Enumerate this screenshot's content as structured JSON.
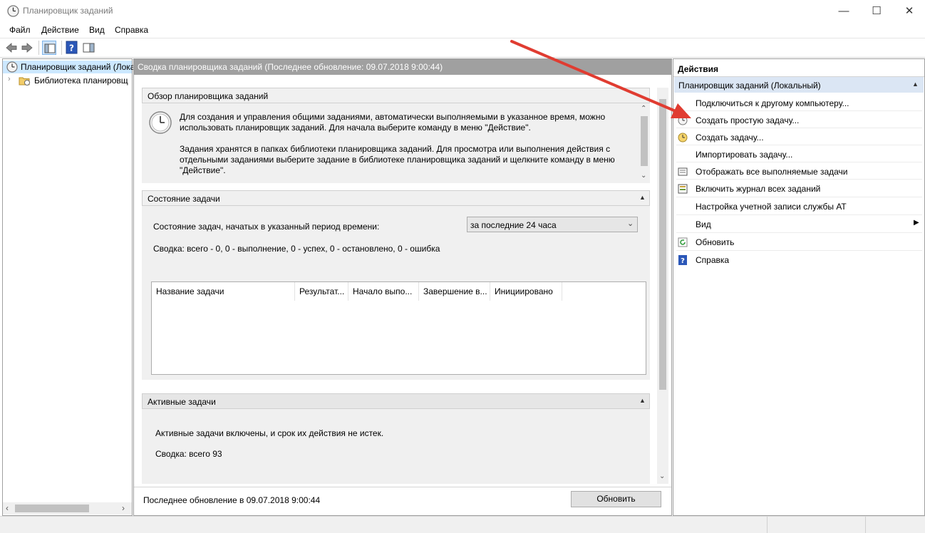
{
  "window": {
    "title": "Планировщик заданий",
    "minimize": "—",
    "maximize": "☐",
    "close": "✕"
  },
  "menu": {
    "items": [
      "Файл",
      "Действие",
      "Вид",
      "Справка"
    ]
  },
  "tree": {
    "root": "Планировщик заданий (Лока",
    "library": "Библиотека планировщ"
  },
  "center": {
    "header": "Сводка планировщика заданий (Последнее обновление: 09.07.2018 9:00:44)",
    "overview": {
      "title": "Обзор планировщика заданий",
      "p1": "Для создания и управления общими заданиями, автоматически выполняемыми в указанное время, можно использовать планировщик заданий. Для начала выберите команду в меню \"Действие\".",
      "p2": "Задания хранятся в папках библиотеки планировщика заданий. Для просмотра или выполнения действия с отдельными заданиями выберите задание в библиотеке планировщика заданий и щелкните команду в меню \"Действие\"."
    },
    "status": {
      "title": "Состояние задачи",
      "period_label": "Состояние задач, начатых в указанный период времени:",
      "period_value": "за последние 24 часа",
      "summary": "Сводка: всего - 0, 0 - выполнение, 0 - успех, 0 - остановлено, 0 - ошибка",
      "columns": [
        "Название задачи",
        "Результат...",
        "Начало выпо...",
        "Завершение в...",
        "Инициировано"
      ]
    },
    "active": {
      "title": "Активные задачи",
      "line1": "Активные задачи включены, и срок их действия не истек.",
      "line2": "Сводка: всего 93"
    },
    "footer": {
      "last_update": "Последнее обновление в 09.07.2018 9:00:44",
      "refresh_button": "Обновить"
    }
  },
  "actions": {
    "title": "Действия",
    "group": "Планировщик заданий (Локальный)",
    "items": [
      "Подключиться к другому компьютеру...",
      "Создать простую задачу...",
      "Создать задачу...",
      "Импортировать задачу...",
      "Отображать все выполняемые задачи",
      "Включить журнал всех заданий",
      "Настройка учетной записи службы AT",
      "Вид",
      "Обновить",
      "Справка"
    ]
  },
  "colors": {
    "accent_header": "#dbe6f4",
    "arrow": "#e03c31",
    "center_header": "#a0a0a0"
  }
}
